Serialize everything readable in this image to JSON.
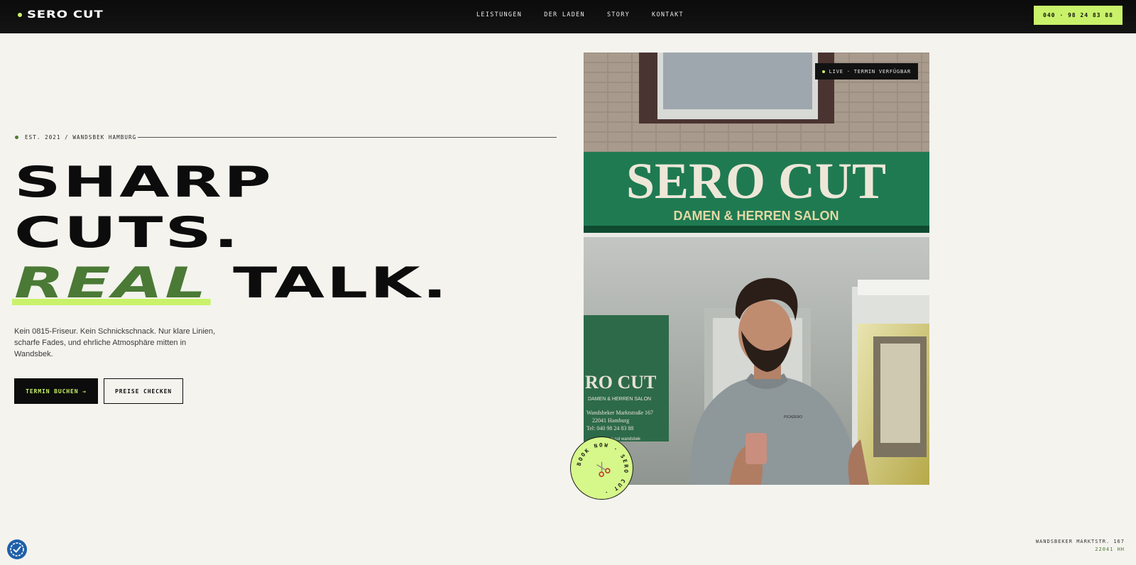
{
  "nav": {
    "brand": "SERO CUT",
    "links": [
      "LEISTUNGEN",
      "DER LADEN",
      "STORY",
      "KONTAKT"
    ],
    "phone": "040 · 98 24 83 88"
  },
  "hero": {
    "eyebrow": "EST. 2021 / WANDSBEK HAMBURG",
    "headline_line1": "SHARP",
    "headline_line2": "CUTS.",
    "headline_real": "REAL",
    "headline_talk": "TALK.",
    "lead": "Kein 0815-Friseur. Kein Schnickschnack. Nur klare Linien, scharfe Fades, und ehrliche Atmosphäre mitten in Wandsbek.",
    "cta_primary": "TERMIN BUCHEN →",
    "cta_secondary": "PREISE CHECKEN"
  },
  "photo": {
    "live_badge": "LIVE · TERMIN VERFÜGBAR",
    "sign_main": "SERO CUT",
    "sign_sub": "DAMEN & HERREN SALON",
    "window_sign_main": "RO CUT",
    "window_sign_sub": "DAMEN & HERREN SALON",
    "window_sign_address": "Wandsbeker Marktstraße 167",
    "window_sign_city": "22041 Hamburg",
    "window_sign_tel": "Tel: 040 98 24 83 88",
    "window_sign_social": "sero cut wandsbek",
    "shirt_logo": "PICADERO"
  },
  "seal": {
    "ring_text": "BOOK NOW · SERO CUT ·",
    "icon": "scissors-icon"
  },
  "footer": {
    "street": "WANDSBEKER MARKTSTR. 167",
    "zip": "22041 HH"
  },
  "colors": {
    "accent": "#c9f26a",
    "green": "#4a7a35",
    "dark": "#0c0c0c",
    "background": "#f4f3ee",
    "sign_green": "#1f7a52"
  }
}
